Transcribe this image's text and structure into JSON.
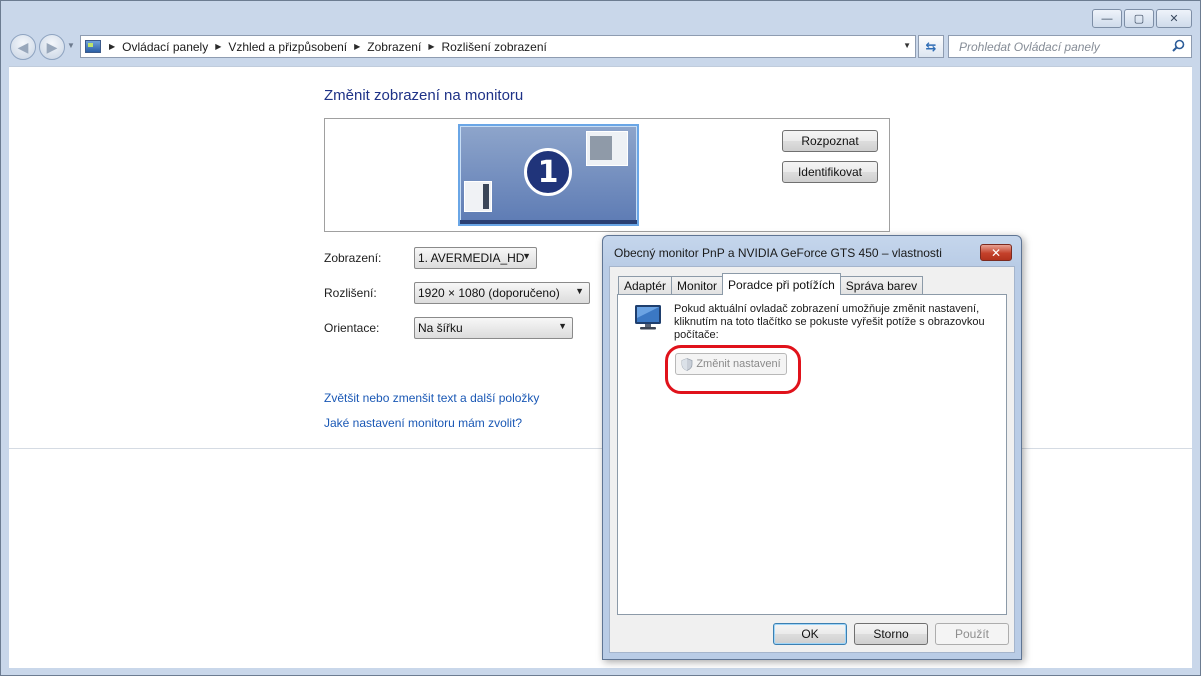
{
  "window": {
    "controls": {
      "minimize": "—",
      "maximize": "▢",
      "close": "✕"
    }
  },
  "navigation": {
    "breadcrumb": [
      "Ovládací panely",
      "Vzhled a přizpůsobení",
      "Zobrazení",
      "Rozlišení zobrazení"
    ],
    "search_placeholder": "Prohledat Ovládací panely"
  },
  "page": {
    "title": "Změnit zobrazení na monitoru",
    "monitor_number": "1",
    "buttons": {
      "detect": "Rozpoznat",
      "identify": "Identifikovat"
    },
    "form": {
      "display_label": "Zobrazení:",
      "display_value": "1. AVERMEDIA_HD",
      "resolution_label": "Rozlišení:",
      "resolution_value": "1920 × 1080 (doporučeno)",
      "orientation_label": "Orientace:",
      "orientation_value": "Na šířku"
    },
    "links": {
      "text_size": "Zvětšit nebo zmenšit text a další položky",
      "which_settings": "Jaké nastavení monitoru mám zvolit?"
    }
  },
  "dialog": {
    "title": "Obecný monitor PnP a NVIDIA GeForce GTS 450    – vlastnosti",
    "close": "✕",
    "tabs": [
      "Adaptér",
      "Monitor",
      "Poradce při potížích",
      "Správa barev"
    ],
    "active_tab": "Poradce při potížích",
    "troubleshoot_text": "Pokud aktuální ovladač zobrazení umožňuje změnit nastavení, kliknutím na toto tlačítko se pokuste vyřešit potíže s obrazovkou počítače:",
    "change_settings": "Změnit nastavení",
    "buttons": {
      "ok": "OK",
      "cancel": "Storno",
      "apply": "Použít"
    }
  },
  "colors": {
    "highlight": "#e0121b",
    "link": "#1a58b5",
    "title": "#1e3287"
  }
}
